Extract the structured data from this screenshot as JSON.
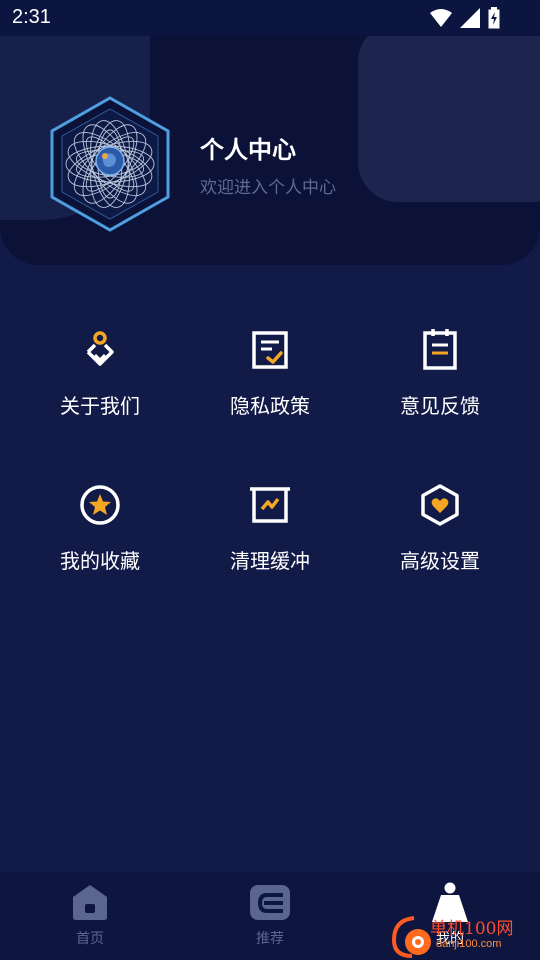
{
  "status_bar": {
    "time": "2:31",
    "icons": [
      "wifi-icon",
      "signal-icon",
      "battery-charging-icon"
    ]
  },
  "profile": {
    "title": "个人中心",
    "subtitle": "欢迎进入个人中心",
    "avatar_icon": "hexagon-globe-avatar"
  },
  "menu": {
    "items": [
      {
        "label": "关于我们",
        "icon": "about-us-icon"
      },
      {
        "label": "隐私政策",
        "icon": "privacy-policy-icon"
      },
      {
        "label": "意见反馈",
        "icon": "feedback-icon"
      },
      {
        "label": "我的收藏",
        "icon": "star-favorites-icon"
      },
      {
        "label": "清理缓冲",
        "icon": "clear-cache-icon"
      },
      {
        "label": "高级设置",
        "icon": "advanced-settings-icon"
      }
    ]
  },
  "bottom_nav": {
    "items": [
      {
        "label": "首页",
        "icon": "home-icon",
        "active": false
      },
      {
        "label": "推荐",
        "icon": "recommend-icon",
        "active": false
      },
      {
        "label": "我的",
        "icon": "user-icon",
        "active": true
      }
    ]
  },
  "watermark": {
    "title": "单机100网",
    "subtitle": "danji100.com"
  },
  "colors": {
    "background": "#121b48",
    "header": "#0b1137",
    "accent": "#f5a623",
    "avatar_ring": "#4d9fe0",
    "subtitle_text": "#5f6a95",
    "nav_inactive": "#5a6590"
  }
}
